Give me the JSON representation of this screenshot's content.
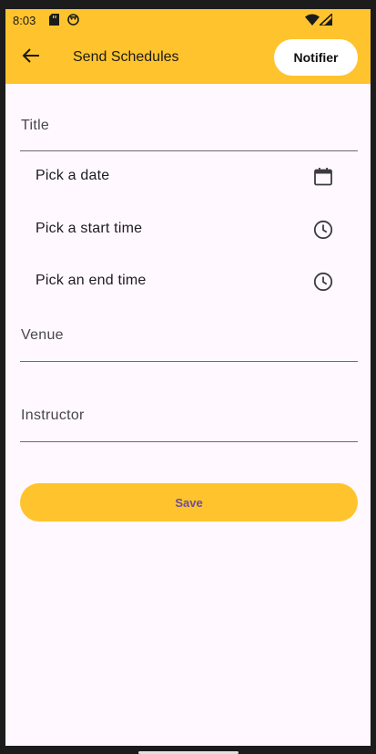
{
  "status_bar": {
    "time": "8:03"
  },
  "app_bar": {
    "title": "Send Schedules",
    "notifier_label": "Notifier"
  },
  "form": {
    "title_label": "Title",
    "pick_date_label": "Pick a date",
    "pick_start_label": "Pick a start time",
    "pick_end_label": "Pick an end time",
    "venue_label": "Venue",
    "instructor_label": "Instructor",
    "save_label": "Save"
  },
  "icons": {
    "back": "arrow-back-icon",
    "date": "calendar-icon",
    "start": "clock-icon",
    "end": "clock-icon"
  },
  "colors": {
    "accent": "#FFC42D",
    "background": "#FFF8FE",
    "save_text": "#6b4f9a"
  }
}
